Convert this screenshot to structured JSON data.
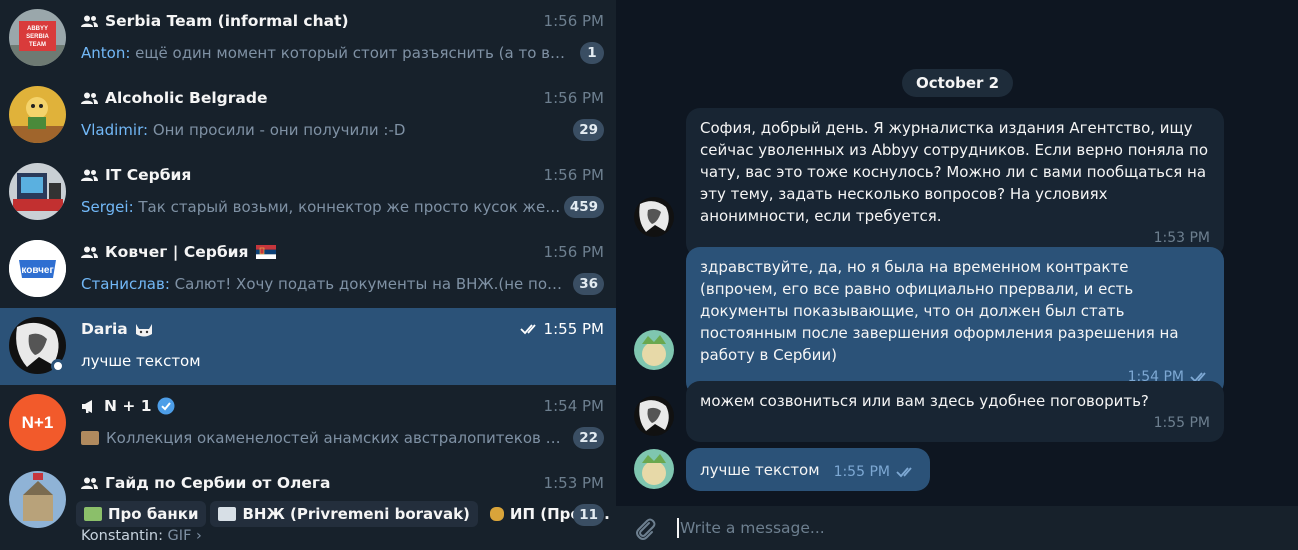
{
  "chats": [
    {
      "title": "Serbia Team (informal chat)",
      "time": "1:56 PM",
      "sender": "Anton:",
      "preview": " ещё один момент который стоит разъяснить (а то во в...",
      "badge": "1",
      "avatar_text": "ABBYY SERBIA TEAM"
    },
    {
      "title": "Alcoholic Belgrade",
      "time": "1:56 PM",
      "sender": "Vladimir:",
      "preview": " Они просили - они получили :-D",
      "badge": "29"
    },
    {
      "title": "IT Сербия",
      "time": "1:56 PM",
      "sender": "Sergei:",
      "preview": " Так старый возьми, коннектор же просто кусок желе...",
      "badge": "459"
    },
    {
      "title": "Ковчег | Сербия",
      "time": "1:56 PM",
      "sender": "Станислав:",
      "preview": " Салют! Хочу подать документы на ВНЖ.(не получ...",
      "badge": "36",
      "avatar_text": "ковчег"
    },
    {
      "title": "Daria",
      "time": "1:55 PM",
      "preview": "лучше текстом"
    },
    {
      "title": "N + 1",
      "time": "1:54 PM",
      "preview": "Коллекция окаменелостей анамских австралопитеков по...",
      "badge": "22",
      "avatar_text": "N+1"
    },
    {
      "title": "Гайд по Сербии от Олега",
      "time": "1:53 PM",
      "badge": "11",
      "folders": [
        "Про банки",
        "ВНЖ (Privremeni boravak)",
        "ИП (Пред..."
      ],
      "sender": "Konstantin:",
      "preview": " GIF ›"
    }
  ],
  "conversation": {
    "date": "October 2",
    "messages": [
      {
        "text": "София, добрый день. Я журналистка издания Агентство, ищу сейчас уволенных из Abbyy сотрудников. Если верно поняла по чату, вас это тоже коснулось? Можно ли с вами пообщаться на эту тему, задать несколько вопросов? На условиях анонимности, если требуется.",
        "time": "1:53 PM"
      },
      {
        "text": "здравствуйте, да, но я была на временном контракте (впрочем, его все равно официально прервали, и есть документы показывающие, что он должен был стать постоянным после завершения оформления разрешения на работу в Сербии)",
        "time": "1:54 PM"
      },
      {
        "text": "можем созвониться или вам здесь удобнее поговорить?",
        "time": "1:55 PM"
      },
      {
        "text": "лучше текстом",
        "time": "1:55 PM"
      }
    ]
  },
  "composer": {
    "placeholder": "Write a message..."
  },
  "colors": {
    "sidebar_bg": "#17212b",
    "chat_bg": "#0e1621",
    "active_row": "#2b5278",
    "incoming_bubble": "#182533",
    "outgoing_bubble": "#2b5278",
    "accent_blue": "#72b8f7",
    "muted": "#6d7f8f"
  }
}
